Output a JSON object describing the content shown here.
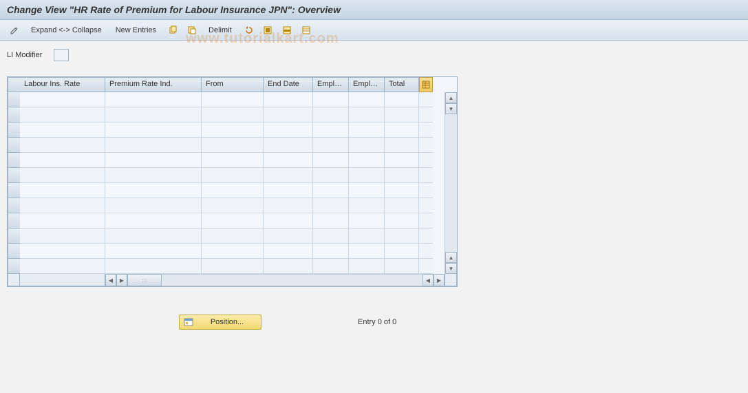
{
  "title": "Change View \"HR Rate of Premium for Labour Insurance JPN\": Overview",
  "toolbar": {
    "expand_collapse": "Expand <-> Collapse",
    "new_entries": "New Entries",
    "delimit": "Delimit"
  },
  "field": {
    "li_modifier_label": "LI Modifier",
    "li_modifier_value": ""
  },
  "grid": {
    "columns": [
      "Labour Ins. Rate",
      "Premium Rate Ind.",
      "From",
      "End Date",
      "Emplo...",
      "Emplo...",
      "Total"
    ],
    "row_count": 12
  },
  "footer": {
    "position_label": "Position...",
    "entry_text": "Entry 0 of 0"
  },
  "watermark": "www.tutorialkart.com"
}
